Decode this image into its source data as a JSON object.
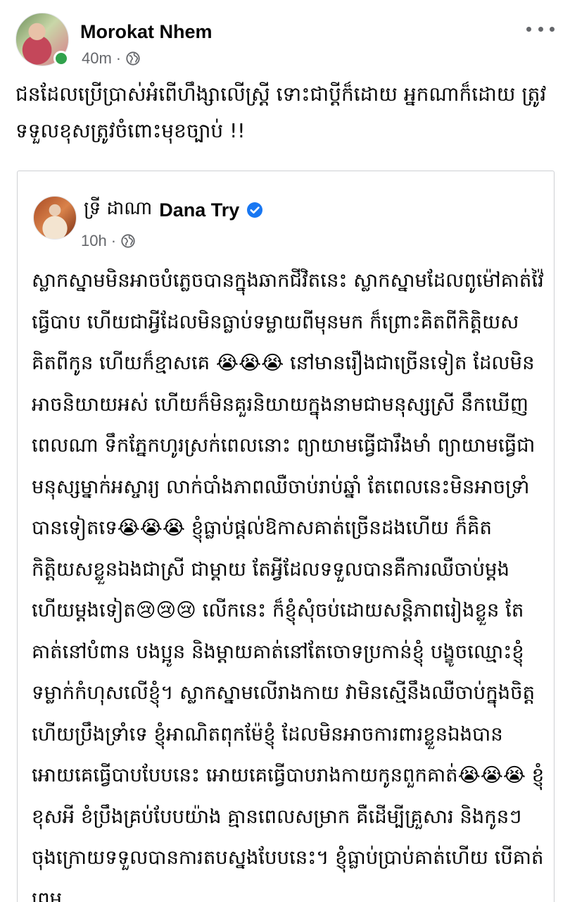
{
  "post": {
    "author": "Morokat Nhem",
    "time": "40m",
    "separator": "·",
    "privacy_icon": "globe-icon",
    "online": true,
    "more_icon": "more-options-icon",
    "text": "ជនដែលប្រើប្រាស់អំពើហឹង្សាលើស្រ្តី ទោះជាប្តីក៏ដោយ អ្នកណាក៏ដោយ ត្រូវទទួលខុសត្រូវចំពោះមុខច្បាប់ !!"
  },
  "shared_post": {
    "author_khmer": "ទ្រី ដាណា",
    "author_latin": "Dana Try",
    "verified_icon": "verified-badge-icon",
    "time": "10h",
    "separator": "·",
    "privacy_icon": "globe-icon",
    "text": "ស្លាកស្នាមមិនអាចបំភ្លេចបានក្នុងឆាកជីវិតនេះ ស្លាកស្នាមដែលពូម៉ៅគាត់វ៉ៃធ្វើបាប ហើយជាអ្វីដែលមិនធ្លាប់ទម្លាយពីមុនមក ក៏ព្រោះគិតពីកិត្តិយស គិតពីកូន ហើយក៏ខ្មាសគេ 😭😭😭 នៅមានរឿងជាច្រើនទៀត ដែលមិនអាចនិយាយអស់ ហើយក៏មិនគួរនិយាយក្នុងនាមជាមនុស្សស្រី នឹកឃើញពេលណា ទឹកភ្នែកហូរស្រក់ពេលនោះ ព្យាយាមធ្វើជារឹងមាំ ព្យាយាមធ្វើជាមនុស្សម្នាក់អស្ចារ្យ លាក់បាំងភាពឈឺចាប់រាប់ឆ្នាំ តែពេលនេះមិនអាចទ្រាំបានទៀតទេ😭😭😭 ខ្ញុំធ្លាប់ផ្តល់ឱកាសគាត់ច្រើនដងហើយ ក៏គិតកិត្តិយសខ្លួនឯងជាស្រី ជាម្តាយ តែអ្វីដែលទទួលបានគឺការឈឺចាប់ម្តងហើយម្តងទៀត😢😢😢 លើកនេះ ក៏ខ្ញុំសុំចប់ដោយសន្តិភាពរៀងខ្លួន តែគាត់នៅបំពាន បងប្អូន និងម្តាយគាត់នៅតែចោទប្រកាន់ខ្ញុំ បង្ខូចឈ្មោះខ្ញុំ ទម្លាក់កំហុសលើខ្ញុំ។ ស្លាកស្នាមលើរាងកាយ វាមិនស្មើនឹងឈឺចាប់ក្នុងចិត្ត ហើយប្រឹងទ្រាំទេ ខ្ញុំអាណិតពុកម៉ែខ្ញុំ ដែលមិនអាចការពារខ្លួនឯងបាន អោយគេធ្វើបាបបែបនេះ អោយគេធ្វើបាបរាងកាយកូនពួកគាត់😭😭😭 ខ្ញុំខុសអី ខំប្រឹងគ្រប់បែបយ៉ាង គ្មានពេលសម្រាក គឺដើម្បីគ្រួសារ និងកូនៗ ចុងក្រោយទទួលបានការតបស្នងបែបនេះ។ ខ្ញុំធ្លាប់ប្រាប់គាត់ហើយ បើគាត់ព្រម"
  },
  "colors": {
    "text": "#050505",
    "meta": "#65676b",
    "online": "#31a24c",
    "verified": "#1877f2",
    "card_border": "#ced0d4"
  }
}
